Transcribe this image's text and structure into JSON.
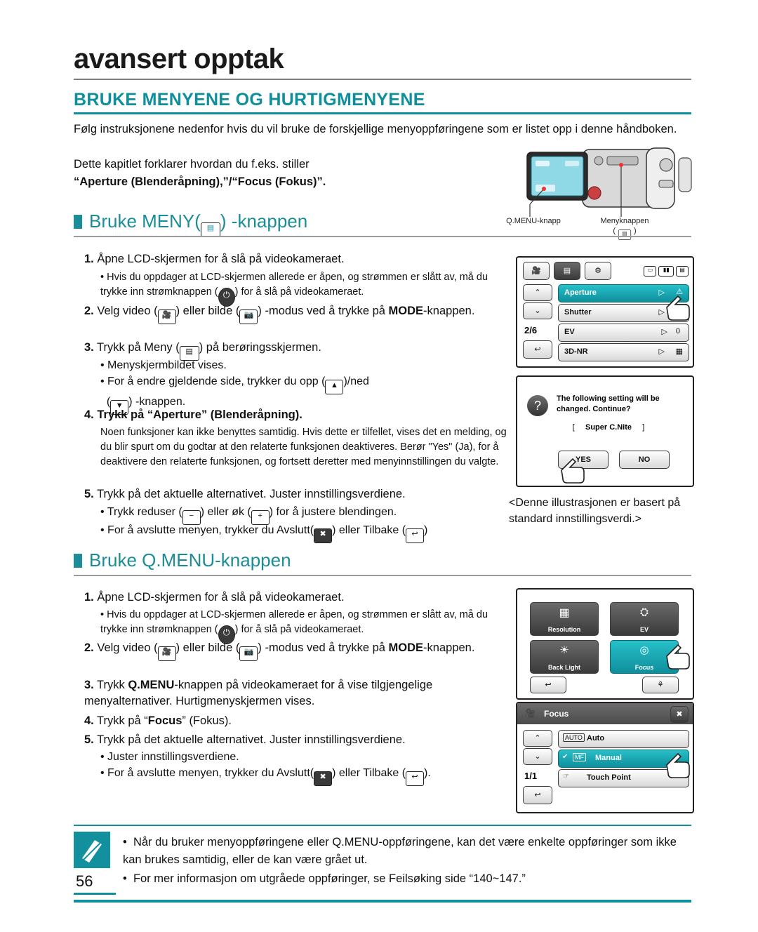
{
  "header": {
    "chapter_title": "avansert opptak",
    "section_title": "BRUKE MENYENE OG HURTIGMENYENE",
    "intro": "Følg instruksjonene nedenfor hvis du vil bruke de forskjellige menyoppføringene som er listet opp i denne håndboken.",
    "intro_2": "Dette kapitlet forklarer hvordan du f.eks. stiller",
    "intro_3": "“Aperture (Blenderåpning),”/“Focus (Fokus)”."
  },
  "section_menu": {
    "heading_pre": "Bruke MENY(",
    "heading_post": ") -knappen",
    "steps": [
      {
        "num": "1.",
        "text": "Åpne LCD-skjermen for å slå på videokameraet.",
        "bullets": [
          "Hvis du oppdager at LCD-skjermen allerede er åpen, og strømmen er slått av, må du trykke inn strømknappen ( ) for å slå på videokameraet."
        ]
      },
      {
        "num": "2.",
        "text": "Velg video ( ) eller bilde ( ) -modus ved å trykke på MODE-knappen.",
        "bullets": []
      },
      {
        "num": "3.",
        "text": "Trykk på Meny ( ) på berøringsskjermen.",
        "bullets": [
          "Menyskjermbildet vises.",
          "For å endre gjeldende side, trykker du opp ( )/ned ( ) -knappen."
        ]
      },
      {
        "num": "4.",
        "text": "Trykk på “Aperture” (Blenderåpning).",
        "bullets": [
          "Noen funksjoner kan ikke benyttes samtidig. Hvis dette er tilfellet, vises det en melding, og du blir spurt om du godtar at den relaterte funksjonen deaktiveres. Berør \"Yes\" (Ja), for å deaktivere den relaterte funksjonen, og fortsett deretter med menyinnstillingen du valgte."
        ]
      },
      {
        "num": "5.",
        "text": "Trykk på det aktuelle alternativet. Juster innstillingsverdiene.",
        "bullets": [
          "Trykk reduser ( ) eller øk ( ) for å justere blendingen.",
          "For å avslutte menyen, trykker du Avslutt( ) eller Tilbake ( )."
        ]
      }
    ]
  },
  "section_qmenu": {
    "heading": "Bruke Q.MENU-knappen",
    "steps": [
      {
        "num": "1.",
        "text": "Åpne LCD-skjermen for å slå på videokameraet.",
        "bullets": [
          "Hvis du oppdager at LCD-skjermen allerede er åpen, og strømmen er slått av, må du trykke inn strømknappen ( ) for å slå på videokameraet."
        ]
      },
      {
        "num": "2.",
        "text": "Velg video ( ) eller bilde ( ) -modus ved å trykke på MODE-knappen.",
        "bullets": []
      },
      {
        "num": "3.",
        "text": "Trykk Q.MENU-knappen på videokameraet for å vise tilgjengelige menyalternativer. Hurtigmenyskjermen vises.",
        "bullets": []
      },
      {
        "num": "4.",
        "text": "Trykk på “Focus” (Fokus).",
        "bullets": []
      },
      {
        "num": "5.",
        "text": "Trykk på det aktuelle alternativet. Juster innstillingsverdiene.",
        "bullets": [
          "Juster innstillingsverdiene.",
          "For å avslutte menyen, trykker du Avslutt( ) eller Tilbake ( )."
        ]
      }
    ]
  },
  "camera_diagram": {
    "label_left": "Q.MENU-knapp",
    "label_right": "Menyknappen",
    "label_right_sub": "( )"
  },
  "screens": {
    "menu_screen": {
      "page_indicator": "2/6",
      "rows": [
        {
          "label": "Aperture",
          "value": ""
        },
        {
          "label": "Shutter",
          "value": ""
        },
        {
          "label": "EV",
          "value": "0"
        },
        {
          "label": "3D-NR",
          "value": ""
        }
      ]
    },
    "dialog_screen": {
      "message_line1": "The following setting will be",
      "message_line2": "changed. Continue?",
      "target": "Super C.Nite",
      "yes": "YES",
      "no": "NO"
    },
    "qmenu_screen": {
      "tiles": [
        {
          "label": "Resolution"
        },
        {
          "label": "EV"
        },
        {
          "label": "Back Light"
        },
        {
          "label": "Focus"
        }
      ]
    },
    "focus_screen": {
      "title": "Focus",
      "page_indicator": "1/1",
      "options": [
        {
          "label": "Auto",
          "badge": "AUTO"
        },
        {
          "label": "Manual",
          "badge": "MF"
        },
        {
          "label": "Touch Point",
          "badge": ""
        }
      ]
    }
  },
  "note": "<Denne illustrasjonen er basert på standard innstillingsverdi.>",
  "footer": {
    "bullets": [
      "Når du bruker menyoppføringene eller Q.MENU-oppføringene, kan det være enkelte oppføringer som ikke kan brukes samtidig, eller de kan være grået ut.",
      "For mer informasjon om utgråede oppføringer, se Feilsøking side “140~147.”"
    ],
    "page_number": "56"
  }
}
